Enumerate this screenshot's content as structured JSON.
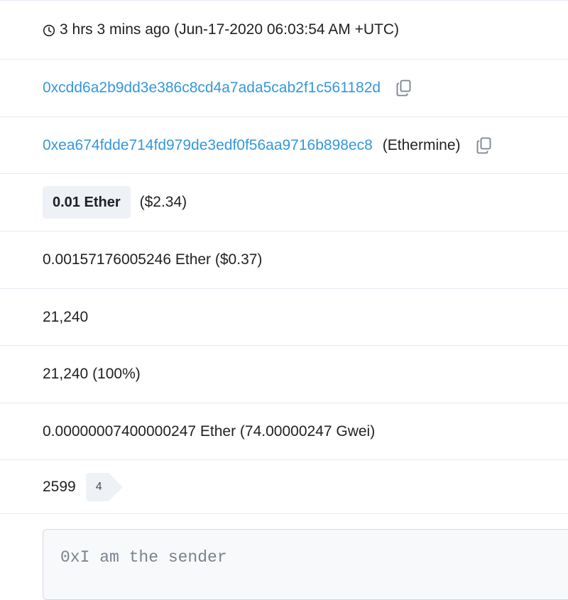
{
  "timestamp": {
    "icon": "clock-icon",
    "text": "3 hrs 3 mins ago (Jun-17-2020 06:03:54 AM +UTC)"
  },
  "from": {
    "address": "0xcdd6a2b9dd3e386c8cd4a7ada5cab2f1c561182d",
    "copy_icon": "copy-icon"
  },
  "to": {
    "address": "0xea674fdde714fd979de3edf0f56aa9716b898ec8",
    "name": "(Ethermine)",
    "copy_icon": "copy-icon"
  },
  "value": {
    "amount": "0.01 Ether",
    "usd": "($2.34)"
  },
  "fee": {
    "text": "0.00157176005246 Ether ($0.37)"
  },
  "gas_limit": {
    "text": "21,240"
  },
  "gas_used": {
    "text": "21,240 (100%)"
  },
  "gas_price": {
    "text": "0.00000007400000247 Ether (74.00000247 Gwei)"
  },
  "nonce": {
    "value": "2599",
    "position": "4"
  },
  "input_data": {
    "text": "0xI am the sender"
  },
  "colors": {
    "link": "#3498db",
    "text": "#1e2022",
    "badge_bg": "#eef1f5",
    "divider": "#e7eaf3"
  }
}
